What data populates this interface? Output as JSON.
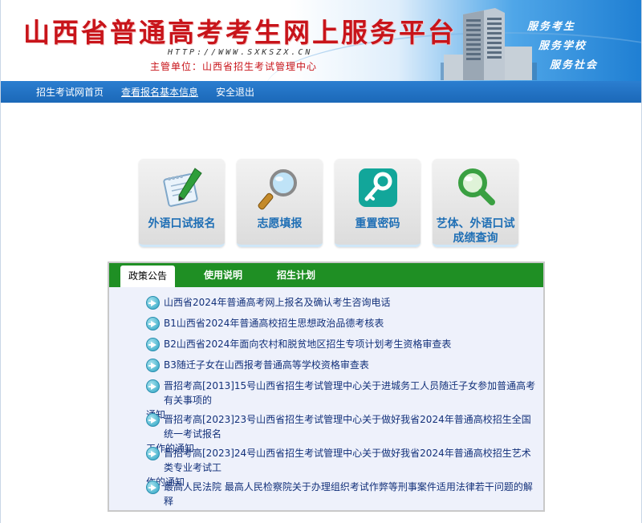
{
  "header": {
    "title": "山西省普通高考考生网上服务平台",
    "url": "HTTP://WWW.SXKSZX.CN",
    "host": "主管单位：山西省招生考试管理中心",
    "slogans": [
      "服务考生",
      "服务学校",
      "服务社会"
    ]
  },
  "nav": {
    "items": [
      {
        "label": "招生考试网首页"
      },
      {
        "label": "查看报名基本信息"
      },
      {
        "label": "安全退出"
      }
    ]
  },
  "tiles": [
    {
      "label": "外语口试报名",
      "icon": "notebook-pencil-icon"
    },
    {
      "label": "志愿填报",
      "icon": "magnifier-icon"
    },
    {
      "label": "重置密码",
      "icon": "key-icon"
    },
    {
      "label_line1": "艺体、外语口试",
      "label_line2": "成绩查询",
      "icon": "search-icon"
    }
  ],
  "panel": {
    "tabs": [
      {
        "label": "政策公告",
        "active": true
      },
      {
        "label": "使用说明"
      },
      {
        "label": "招生计划"
      }
    ],
    "items": [
      {
        "line1": "山西省2024年普通高考网上报名及确认考生咨询电话"
      },
      {
        "line1": "B1山西省2024年普通高校招生思想政治品德考核表"
      },
      {
        "line1": "B2山西省2024年面向农村和脱贫地区招生专项计划考生资格审查表"
      },
      {
        "line1": "B3随迁子女在山西报考普通高等学校资格审查表"
      },
      {
        "line1": "晋招考高[2013]15号山西省招生考试管理中心关于进城务工人员随迁子女参加普通高考有关事项的",
        "line2": "通知"
      },
      {
        "line1": "晋招考高[2023]23号山西省招生考试管理中心关于做好我省2024年普通高校招生全国统一考试报名",
        "line2": "工作的通知"
      },
      {
        "line1": "晋招考高[2023]24号山西省招生考试管理中心关于做好我省2024年普通高校招生艺术类专业考试工",
        "line2": "作的通知"
      },
      {
        "line1": "最高人民法院 最高人民检察院关于办理组织考试作弊等刑事案件适用法律若干问题的解释"
      }
    ]
  },
  "colors": {
    "title_red": "#c8141a",
    "nav_blue": "#1b68b8",
    "tab_green": "#1f8f24",
    "link_blue": "#1f6fb5",
    "list_bg": "#eef1fb"
  }
}
